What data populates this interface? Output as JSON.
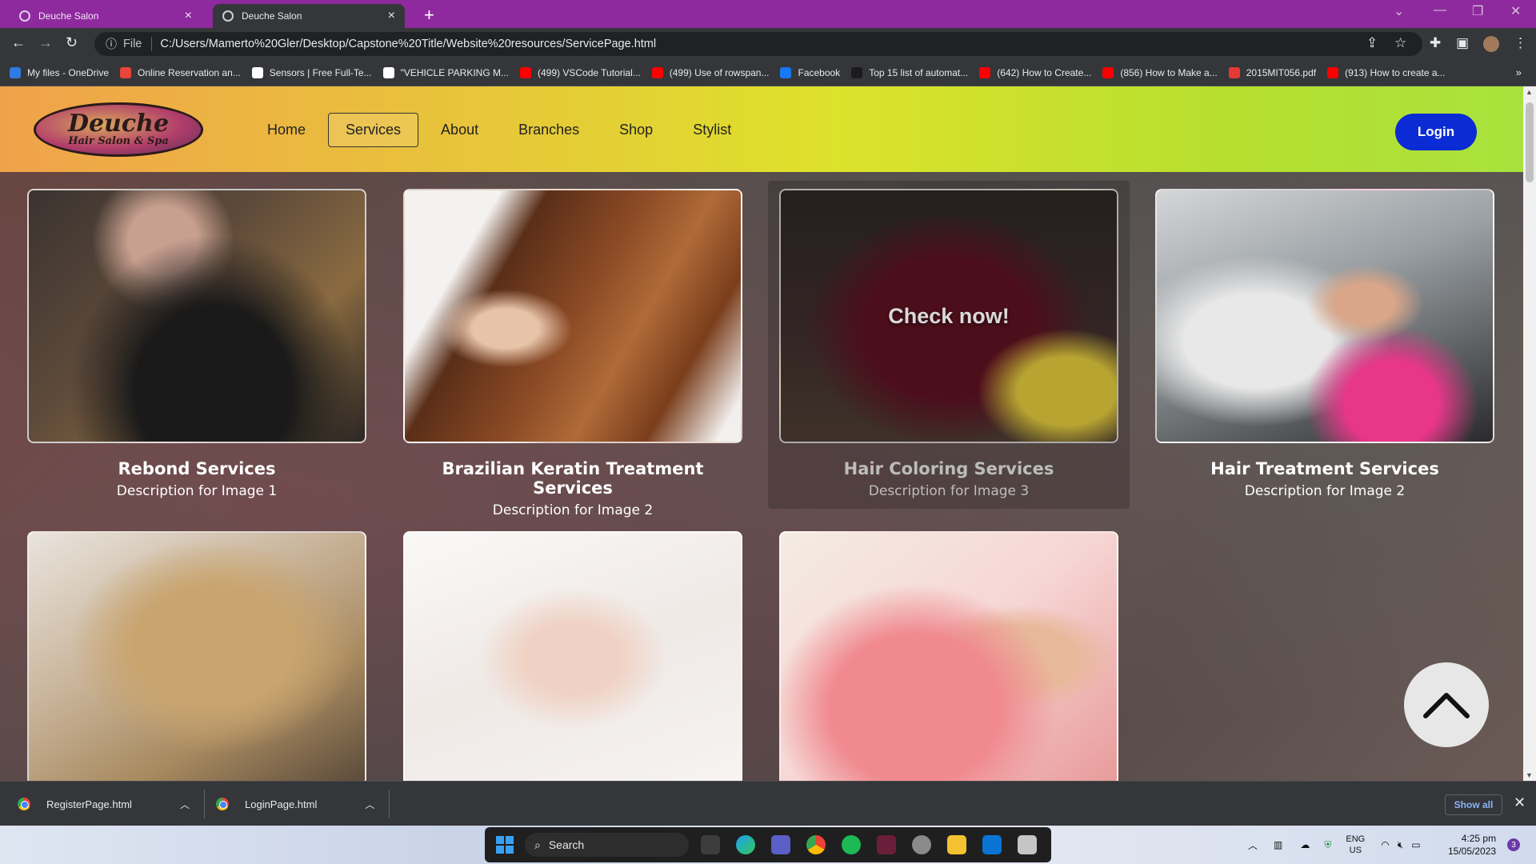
{
  "browser": {
    "tabs": [
      {
        "title": "Deuche Salon",
        "active": false
      },
      {
        "title": "Deuche Salon",
        "active": true
      }
    ],
    "address": {
      "scheme_label": "File",
      "url": "C:/Users/Mamerto%20Gler/Desktop/Capstone%20Title/Website%20resources/ServicePage.html"
    },
    "bookmarks": [
      {
        "label": "My files - OneDrive",
        "icon": "onedrive-icon",
        "color": "#2f7be0"
      },
      {
        "label": "Online Reservation an...",
        "icon": "reservation-icon",
        "color": "#e8443a"
      },
      {
        "label": "Sensors | Free Full-Te...",
        "icon": "mdpi-icon",
        "color": "#ffffff"
      },
      {
        "label": "\"VEHICLE PARKING M...",
        "icon": "slideshare-icon",
        "color": "#ffffff"
      },
      {
        "label": "(499) VSCode Tutorial...",
        "icon": "youtube-icon",
        "color": "#ff0000"
      },
      {
        "label": "(499) Use of rowspan...",
        "icon": "youtube-icon",
        "color": "#ff0000"
      },
      {
        "label": "Facebook",
        "icon": "facebook-icon",
        "color": "#1877f2"
      },
      {
        "label": "Top 15 list of automat...",
        "icon": "bookmark-icon",
        "color": "#1b1b1b"
      },
      {
        "label": "(642) How to Create...",
        "icon": "youtube-icon",
        "color": "#ff0000"
      },
      {
        "label": "(856) How to Make a...",
        "icon": "youtube-icon",
        "color": "#ff0000"
      },
      {
        "label": "2015MIT056.pdf",
        "icon": "pdf-icon",
        "color": "#e53935"
      },
      {
        "label": "(913) How to create a...",
        "icon": "youtube-icon",
        "color": "#ff0000"
      }
    ]
  },
  "site": {
    "logo": {
      "line1": "Deuche",
      "line2": "Hair Salon & Spa"
    },
    "nav": [
      "Home",
      "Services",
      "About",
      "Branches",
      "Shop",
      "Stylist"
    ],
    "active_nav": "Services",
    "login_label": "Login",
    "overlay_text": "Check now!",
    "cards": [
      {
        "title": "Rebond Services",
        "description": "Description for Image 1",
        "image": "hair-rebond-photo"
      },
      {
        "title": "Brazilian Keratin Treatment Services",
        "description": "Description for Image 2",
        "image": "keratin-hair-photo"
      },
      {
        "title": "Hair Coloring Services",
        "description": "Description for Image 3",
        "image": "hair-coloring-photo"
      },
      {
        "title": "Hair Treatment Services",
        "description": "Description for Image 2",
        "image": "hair-wash-photo"
      },
      {
        "title": "",
        "description": "",
        "image": "hair-extension-photo"
      },
      {
        "title": "",
        "description": "",
        "image": "manicure-photo"
      },
      {
        "title": "",
        "description": "",
        "image": "foot-spa-photo"
      }
    ]
  },
  "downloads": {
    "items": [
      "RegisterPage.html",
      "LoginPage.html"
    ],
    "show_all": "Show all"
  },
  "taskbar": {
    "search_placeholder": "Search",
    "language": "ENG",
    "region": "US",
    "time": "4:25 pm",
    "date": "15/05/2023",
    "notification_count": "3"
  },
  "colors": {
    "tab_strip": "#8e2a9e",
    "login_button": "#0b2bd4",
    "header_gradient_start": "#f0a24a",
    "header_gradient_end": "#a9e23d"
  }
}
